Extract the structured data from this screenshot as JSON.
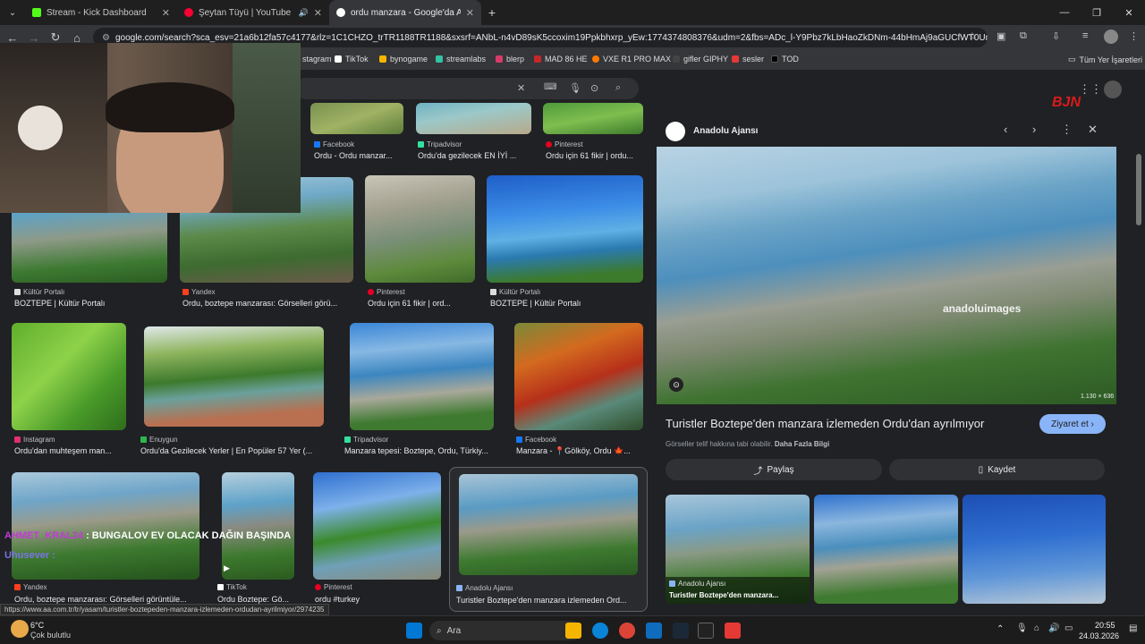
{
  "browser": {
    "tabs": [
      {
        "title": "Stream - Kick Dashboard",
        "color": "#53fc18"
      },
      {
        "title": "Şeytan Tüyü | YouTube Mus",
        "color": "#ff0033"
      },
      {
        "title": "ordu manzara - Google'da Ara",
        "color": "#ffffff"
      }
    ],
    "url": "google.com/search?sca_esv=21a6b12fa57c4177&rlz=1C1CHZO_trTR1188TR1188&sxsrf=ANbL-n4vD89sK5ccoxim19Ppkbhxrp_yEw:1774374808376&udm=2&fbs=ADc_l-Y9Pbz7kLbHaoZkDNm-44bHmAj9aGUCfWT0UmgtvHQtBU...",
    "bookmarks": [
      {
        "label": "stagram",
        "color": "#e1306c"
      },
      {
        "label": "TikTok",
        "color": "#ffffff"
      },
      {
        "label": "bynogame",
        "color": "#f6b500"
      },
      {
        "label": "streamlabs",
        "color": "#31c3a2"
      },
      {
        "label": "blerp",
        "color": "#d93a6a"
      },
      {
        "label": "MAD 86 HE",
        "color": "#c62828"
      },
      {
        "label": "VXE R1 PRO MAX",
        "color": "#ff7a00"
      },
      {
        "label": "gifler GIPHY",
        "color": "#222"
      },
      {
        "label": "sesler",
        "color": "#e53935"
      },
      {
        "label": "TOD",
        "color": "#111"
      }
    ],
    "all_bookmarks": "Tüm Yer İşaretleri"
  },
  "results": [
    {
      "source": "Facebook",
      "title": "Ordu - Ordu manzar...",
      "color": "#1877f2"
    },
    {
      "source": "Tripadvisor",
      "title": "Ordu'da gezilecek EN İYİ ...",
      "color": "#34e0a1"
    },
    {
      "source": "Pinterest",
      "title": "Ordu için 61 fikir | ordu...",
      "color": "#e60023"
    },
    {
      "source": "Kültür Portalı",
      "title": "BOZTEPE | Kültür Portalı",
      "color": "#ddd"
    },
    {
      "source": "Yandex",
      "title": "Ordu, boztepe manzarası: Görselleri görü...",
      "color": "#fc3f1d"
    },
    {
      "source": "Pinterest",
      "title": "Ordu için 61 fikir | ord...",
      "color": "#e60023"
    },
    {
      "source": "Kültür Portalı",
      "title": "BOZTEPE | Kültür Portalı",
      "color": "#ddd"
    },
    {
      "source": "Instagram",
      "title": "Ordu'dan muhteşem man...",
      "color": "#e1306c"
    },
    {
      "source": "Enuygun",
      "title": "Ordu'da Gezilecek Yerler | En Popüler 57 Yer (...",
      "color": "#2db84d"
    },
    {
      "source": "Tripadvisor",
      "title": "Manzara tepesi: Boztepe, Ordu, Türkiy...",
      "color": "#34e0a1"
    },
    {
      "source": "Facebook",
      "title": "Manzara - 📍Gölköy, Ordu 🍁...",
      "color": "#1877f2"
    },
    {
      "source": "Yandex",
      "title": "Ordu, boztepe manzarası: Görselleri görüntüle...",
      "color": "#fc3f1d"
    },
    {
      "source": "TikTok",
      "title": "Ordu Boztepe: Gö...",
      "color": "#fff"
    },
    {
      "source": "Pinterest",
      "title": "ordu #turkey",
      "color": "#e60023"
    },
    {
      "source": "Anadolu Ajansı",
      "title": "Turistler Boztepe'den manzara izlemeden Ord...",
      "color": "#8ab4f8"
    }
  ],
  "panel": {
    "source": "Anadolu Ajansı",
    "title": "Turistler Boztepe'den manzara izlemeden Ordu'dan ayrılmıyor",
    "visit": "Ziyaret et",
    "copyright": "Görseller telif hakkına tabi olabilir.",
    "learn_more": "Daha Fazla Bilgi",
    "share": "Paylaş",
    "save": "Kaydet",
    "dims": "1.130 × 636",
    "watermark": "anadoluimages",
    "related": [
      {
        "source": "Anadolu Ajansı",
        "title": "Turistler Boztepe'den manzara..."
      }
    ]
  },
  "overlay": {
    "chat_name": "AHMET_KRAL24",
    "chat_sep": " : ",
    "chat_msg": "BUNGALOV EV OLACAK DAĞIN BAŞINDA",
    "chat2": "Uhusever :",
    "logo": "BJN"
  },
  "status_url": "https://www.aa.com.tr/tr/yasam/turistler-boztepeden-manzara-izlemeden-ordudan-ayrilmiyor/2974235",
  "taskbar": {
    "temp": "6°C",
    "weather": "Çok bulutlu",
    "search": "Ara",
    "time": "20:55",
    "date": "24.03.2026"
  }
}
